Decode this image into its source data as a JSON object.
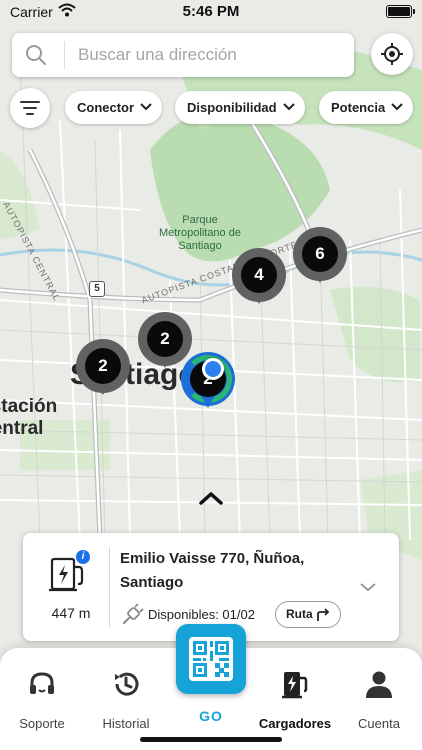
{
  "status_bar": {
    "carrier": "Carrier",
    "time": "5:46 PM"
  },
  "search": {
    "placeholder": "Buscar una dirección"
  },
  "filters": [
    {
      "label": "Conector"
    },
    {
      "label": "Disponibilidad"
    },
    {
      "label": "Potencia"
    }
  ],
  "map": {
    "park_label": "Parque Metropolitano de Santiago",
    "road_label_1": "AUTOPISTA CENTRAL",
    "road_label_2": "AUTOPISTA COSTANERA NORTE",
    "route_shield": "5",
    "city_label": "Santiago",
    "station_label": "Estación Central",
    "clusters": [
      {
        "count": "6"
      },
      {
        "count": "4"
      },
      {
        "count": "2"
      },
      {
        "count": "2"
      },
      {
        "count": "2",
        "selected": true
      }
    ]
  },
  "station_card": {
    "address": "Emilio Vaisse 770, Ñuñoa, Santiago",
    "distance": "447 m",
    "availability": "Disponibles: 01/02",
    "route_button": "Ruta",
    "info_badge": "i"
  },
  "tabbar": {
    "tabs": [
      {
        "label": "Soporte",
        "icon": "headset-icon"
      },
      {
        "label": "Historial",
        "icon": "history-icon"
      },
      {
        "label": "GO",
        "icon": "qr-code-icon"
      },
      {
        "label": "Cargadores",
        "icon": "charger-icon",
        "active": true
      },
      {
        "label": "Cuenta",
        "icon": "user-icon"
      }
    ]
  },
  "colors": {
    "accent": "#15a3d8",
    "selected_pin": "#1d6ed8",
    "available": "#2bb673",
    "info": "#1a72e8"
  }
}
